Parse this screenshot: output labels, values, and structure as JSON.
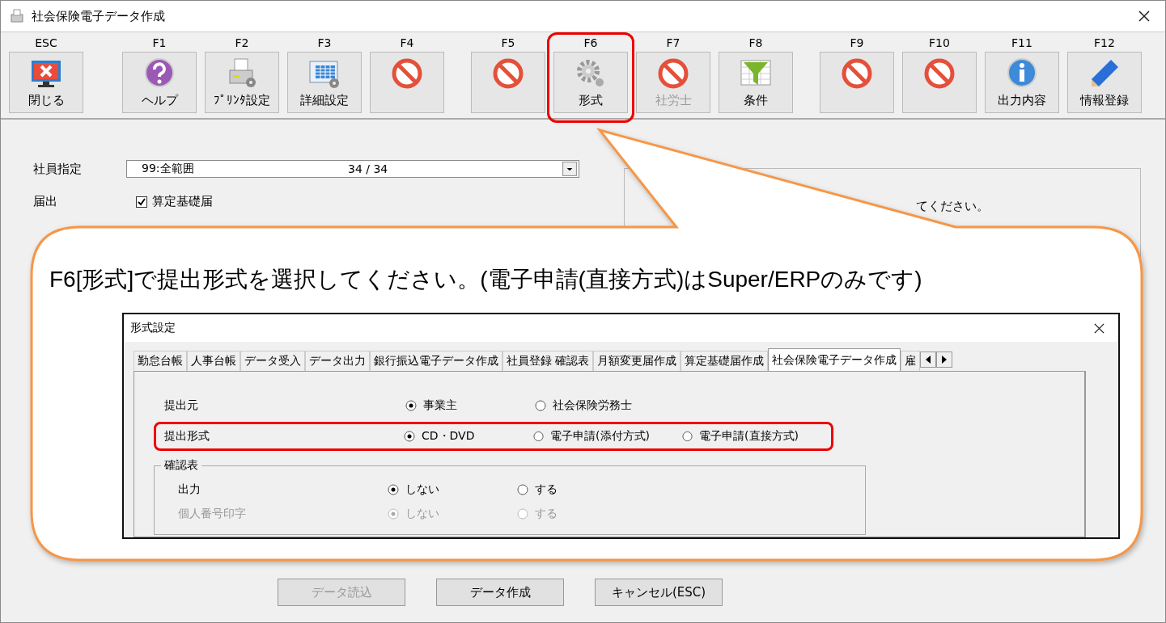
{
  "window": {
    "title": "社会保険電子データ作成"
  },
  "toolbar": [
    {
      "key": "ESC",
      "label": "閉じる",
      "kind": "close",
      "disabled": false,
      "highlighted": false
    },
    {
      "key": "F1",
      "label": "ヘルプ",
      "kind": "help",
      "disabled": false,
      "highlighted": false
    },
    {
      "key": "F2",
      "label": "ﾌﾟﾘﾝﾀ設定",
      "kind": "printer",
      "disabled": false,
      "highlighted": false
    },
    {
      "key": "F3",
      "label": "詳細設定",
      "kind": "table",
      "disabled": false,
      "highlighted": false
    },
    {
      "key": "F4",
      "kind": "prohibited",
      "highlighted": false
    },
    {
      "key": "F5",
      "kind": "prohibited",
      "highlighted": false
    },
    {
      "key": "F6",
      "label": "形式",
      "kind": "gear",
      "disabled": false,
      "highlighted": true
    },
    {
      "key": "F7",
      "label": "社労士",
      "kind": "prohibited",
      "disabled": true,
      "highlighted": false
    },
    {
      "key": "F8",
      "label": "条件",
      "kind": "funnel",
      "disabled": false,
      "highlighted": false
    },
    {
      "key": "F9",
      "kind": "prohibited",
      "highlighted": false
    },
    {
      "key": "F10",
      "kind": "prohibited",
      "highlighted": false
    },
    {
      "key": "F11",
      "label": "出力内容",
      "kind": "info",
      "disabled": false,
      "highlighted": false
    },
    {
      "key": "F12",
      "label": "情報登録",
      "kind": "pencil",
      "disabled": false,
      "highlighted": false
    }
  ],
  "form": {
    "employee": {
      "label": "社員指定",
      "value": "99:全範囲",
      "count": "34 / 34"
    },
    "notification": {
      "label": "届出",
      "option": "算定基礎届",
      "checked": true
    }
  },
  "panel_text": "てください。",
  "callout": {
    "text": "F6[形式]で提出形式を選択してください。(電子申請(直接方式)はSuper/ERPのみです)",
    "dialog": {
      "title": "形式設定",
      "tabs": [
        {
          "label": "勤怠台帳",
          "selected": false
        },
        {
          "label": "人事台帳",
          "selected": false
        },
        {
          "label": "データ受入",
          "selected": false
        },
        {
          "label": "データ出力",
          "selected": false
        },
        {
          "label": "銀行振込電子データ作成",
          "selected": false
        },
        {
          "label": "社員登録 確認表",
          "selected": false
        },
        {
          "label": "月額変更届作成",
          "selected": false
        },
        {
          "label": "算定基礎届作成",
          "selected": false
        },
        {
          "label": "社会保険電子データ作成",
          "selected": true
        },
        {
          "label": "雇",
          "selected": false
        }
      ],
      "rows": [
        {
          "label": "提出元",
          "disabled": false,
          "highlighted": false,
          "options": [
            {
              "label": "事業主",
              "selected": true
            },
            {
              "label": "社会保険労務士",
              "selected": false
            }
          ]
        },
        {
          "label": "提出形式",
          "disabled": false,
          "highlighted": true,
          "options": [
            {
              "label": "CD・DVD",
              "selected": true
            },
            {
              "label": "電子申請(添付方式)",
              "selected": false
            },
            {
              "label": "電子申請(直接方式)",
              "selected": false
            }
          ]
        }
      ],
      "group": {
        "title": "確認表",
        "rows": [
          {
            "label": "出力",
            "disabled": false,
            "options": [
              {
                "label": "しない",
                "selected": true
              },
              {
                "label": "する",
                "selected": false
              }
            ]
          },
          {
            "label": "個人番号印字",
            "disabled": true,
            "options": [
              {
                "label": "しない",
                "selected": true
              },
              {
                "label": "する",
                "selected": false
              }
            ]
          }
        ]
      }
    }
  },
  "buttons": [
    {
      "label": "データ読込",
      "disabled": true
    },
    {
      "label": "データ作成",
      "disabled": false
    },
    {
      "label": "キャンセル(ESC)",
      "disabled": false
    }
  ]
}
